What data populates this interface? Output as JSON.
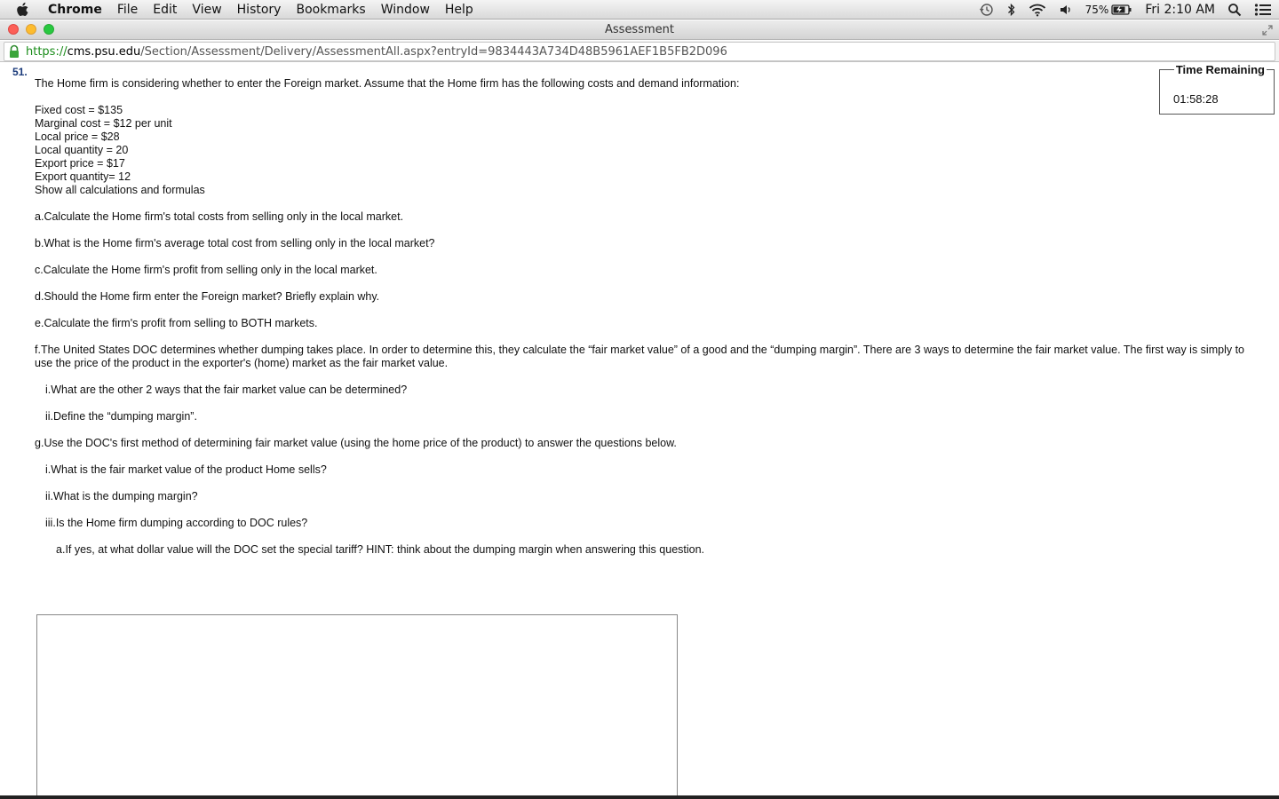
{
  "menubar": {
    "app": "Chrome",
    "items": [
      "File",
      "Edit",
      "View",
      "History",
      "Bookmarks",
      "Window",
      "Help"
    ],
    "battery": "75%",
    "clock": "Fri 2:10 AM"
  },
  "window": {
    "title": "Assessment"
  },
  "address": {
    "scheme": "https",
    "separator": "://",
    "host": "cms.psu.edu",
    "path": "/Section/Assessment/Delivery/AssessmentAll.aspx?entryId=9834443A734D48B5961AEF1B5FB2D096"
  },
  "timer": {
    "label": "Time Remaining",
    "value": "01:58:28"
  },
  "question": {
    "number": "51.",
    "intro": "The Home firm is considering whether to enter the Foreign market.  Assume that the Home firm has the following costs and demand information:",
    "facts": [
      "Fixed cost = $135",
      "Marginal cost = $12 per unit",
      "Local price = $28",
      "Local quantity = 20",
      "Export price = $17",
      "Export quantity= 12",
      "Show all calculations and formulas"
    ],
    "a": {
      "label": "a.",
      "text": "Calculate the Home firm's total costs from selling only in the local market."
    },
    "b": {
      "label": "b.",
      "text": "What is the Home firm's average total cost from selling only in the local market?"
    },
    "c": {
      "label": "c.",
      "text": "Calculate the Home firm's profit from selling only in the local market."
    },
    "d": {
      "label": "d.",
      "text": "Should the Home firm enter the Foreign market? Briefly explain why."
    },
    "e": {
      "label": "e.",
      "text": "Calculate the firm's profit from selling to BOTH markets."
    },
    "f": {
      "label": "f.",
      "text": "The United States DOC determines whether dumping takes place.  In order to determine this, they calculate the “fair market value” of a good and the “dumping margin”.  There are 3 ways to determine the fair market value.  The first way is simply to use the price of the product in the exporter's (home) market as the fair market value.",
      "i": {
        "label": "i.",
        "text": "What are the other 2 ways that the fair market value can be determined?"
      },
      "ii": {
        "label": "ii.",
        "text": "Define the “dumping margin”."
      }
    },
    "g": {
      "label": "g.",
      "text": "Use the DOC's first method of determining fair market value (using the home price of the product) to answer the questions below.",
      "i": {
        "label": "i.",
        "text": "What is the fair market value of the product Home sells?"
      },
      "ii": {
        "label": "ii.",
        "text": "What is the dumping margin?"
      },
      "iii": {
        "label": "iii.",
        "text": "Is the Home firm dumping according to DOC rules?"
      },
      "iii_a": {
        "label": "a.",
        "text": "If yes, at what dollar value will the DOC set the special tariff?  HINT: think about the dumping margin when answering this question."
      }
    }
  }
}
